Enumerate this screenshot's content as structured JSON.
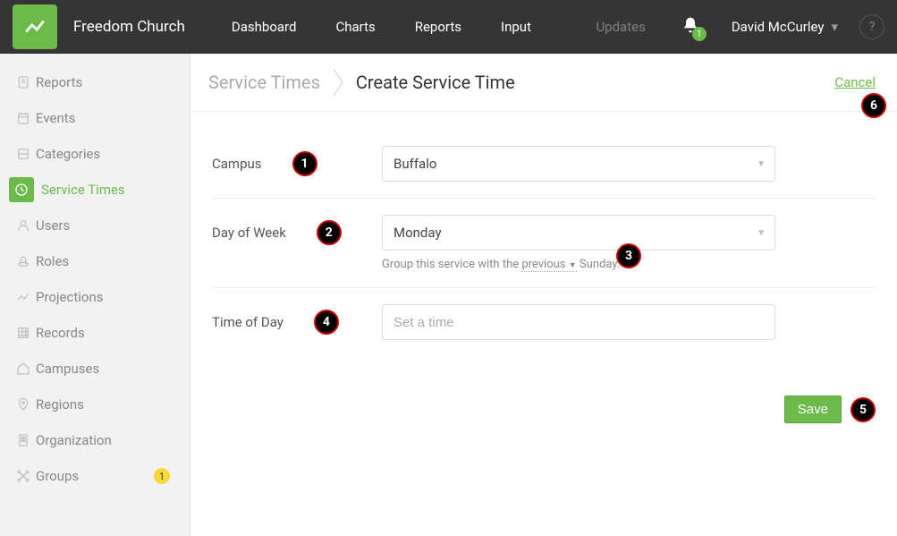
{
  "header": {
    "app_name": "Freedom Church",
    "nav": [
      "Dashboard",
      "Charts",
      "Reports",
      "Input"
    ],
    "muted_nav": "Updates",
    "notification_count": "1",
    "user_name": "David McCurley",
    "help": "?"
  },
  "sidebar": {
    "items": [
      {
        "label": "Reports"
      },
      {
        "label": "Events"
      },
      {
        "label": "Categories"
      },
      {
        "label": "Service Times",
        "active": true
      },
      {
        "label": "Users"
      },
      {
        "label": "Roles"
      },
      {
        "label": "Projections"
      },
      {
        "label": "Records"
      },
      {
        "label": "Campuses"
      },
      {
        "label": "Regions"
      },
      {
        "label": "Organization"
      },
      {
        "label": "Groups",
        "badge": "1"
      }
    ]
  },
  "breadcrumb": {
    "parent": "Service Times",
    "current": "Create Service Time",
    "cancel": "Cancel"
  },
  "form": {
    "campus_label": "Campus",
    "campus_value": "Buffalo",
    "dow_label": "Day of Week",
    "dow_value": "Monday",
    "hint_prefix": "Group this service with the ",
    "hint_dropdown": "previous",
    "hint_suffix": " Sunday.",
    "tod_label": "Time of Day",
    "tod_placeholder": "Set a time",
    "save": "Save"
  },
  "annotations": {
    "a1": "1",
    "a2": "2",
    "a3": "3",
    "a4": "4",
    "a5": "5",
    "a6": "6"
  }
}
